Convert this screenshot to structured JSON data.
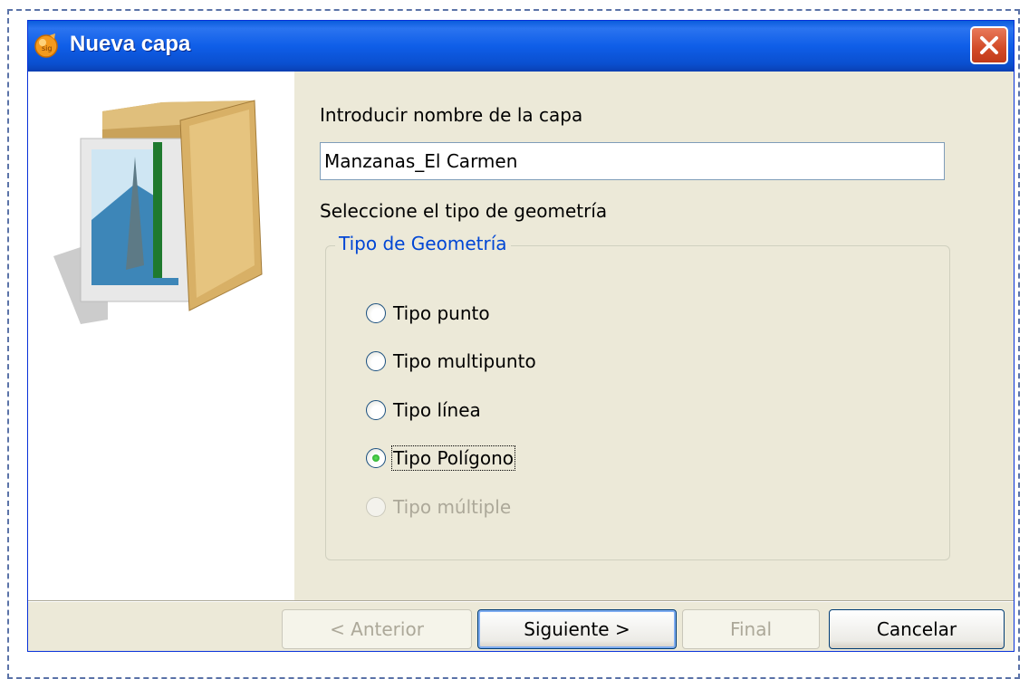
{
  "window": {
    "title": "Nueva capa",
    "icon": "gvsig-logo-icon"
  },
  "form": {
    "name_label": "Introducir nombre de la capa",
    "name_value": "Manzanas_El Carmen",
    "geometry_label": "Seleccione el tipo de geometría"
  },
  "geometry_group": {
    "title": "Tipo de Geometría",
    "options": [
      {
        "label": "Tipo punto",
        "selected": false,
        "enabled": true
      },
      {
        "label": "Tipo multipunto",
        "selected": false,
        "enabled": true
      },
      {
        "label": "Tipo línea",
        "selected": false,
        "enabled": true
      },
      {
        "label": "Tipo Polígono",
        "selected": true,
        "enabled": true
      },
      {
        "label": "Tipo múltiple",
        "selected": false,
        "enabled": false
      }
    ]
  },
  "buttons": {
    "previous": "< Anterior",
    "next": "Siguiente >",
    "finish": "Final",
    "cancel": "Cancelar"
  },
  "colors": {
    "titlebar": "#0a5ddc",
    "dialog_bg": "#ece9d8",
    "group_title": "#0046d5",
    "close_button": "#d24a27"
  }
}
